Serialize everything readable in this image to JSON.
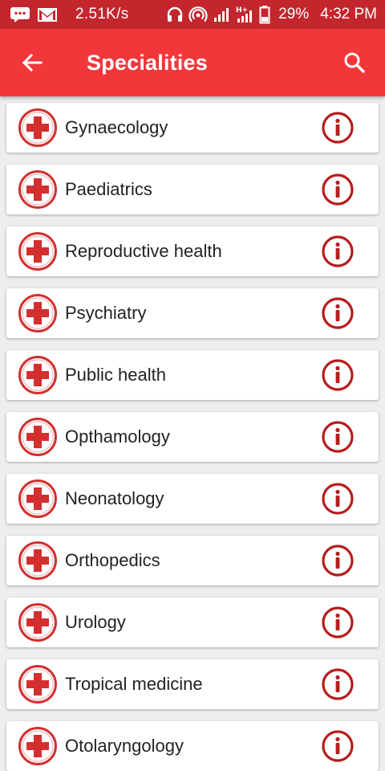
{
  "status_bar": {
    "network_speed": "2.51K/s",
    "battery_percent": "29%",
    "time": "4:32 PM",
    "icons": [
      "chat-icon",
      "gmail-icon",
      "headphones-icon",
      "hotspot-icon",
      "signal-icon",
      "hplus-signal-icon",
      "battery-icon"
    ]
  },
  "app_bar": {
    "title": "Specialities",
    "back_icon": "arrow-back-icon",
    "search_icon": "search-icon"
  },
  "colors": {
    "status_bar": "#c4262e",
    "app_bar": "#f2373a",
    "accent_red": "#d32f2f",
    "info_red": "#b71c1c"
  },
  "specialities": [
    {
      "name": "Gynaecology"
    },
    {
      "name": "Paediatrics"
    },
    {
      "name": "Reproductive health"
    },
    {
      "name": "Psychiatry"
    },
    {
      "name": "Public health"
    },
    {
      "name": "Opthamology"
    },
    {
      "name": "Neonatology"
    },
    {
      "name": "Orthopedics"
    },
    {
      "name": "Urology"
    },
    {
      "name": "Tropical medicine"
    },
    {
      "name": "Otolaryngology"
    }
  ]
}
